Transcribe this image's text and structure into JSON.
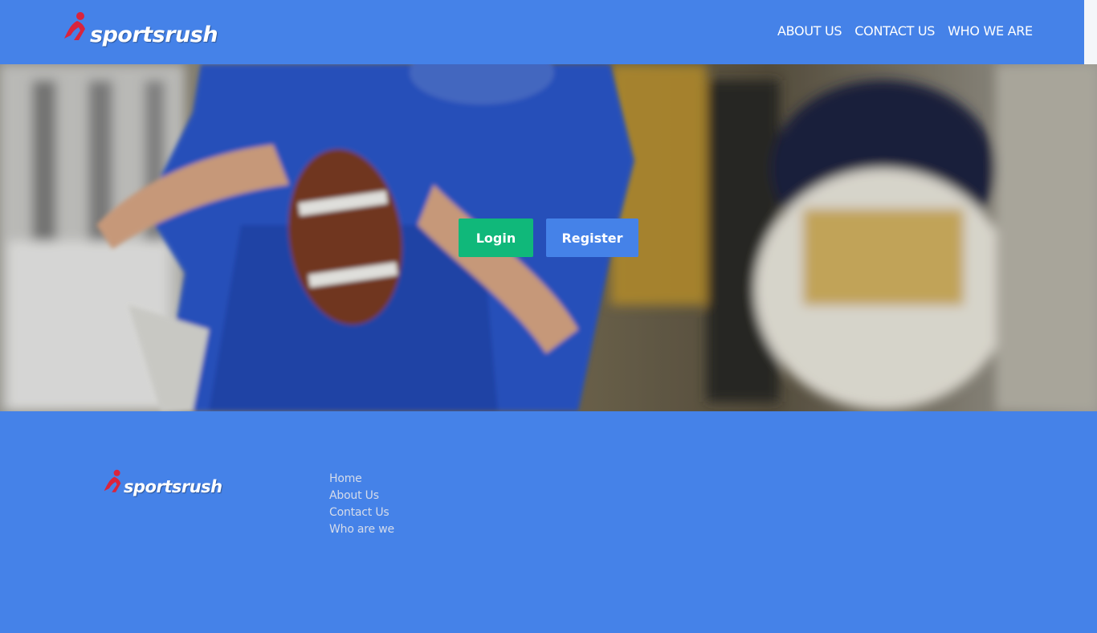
{
  "brand": {
    "name": "sportsrush"
  },
  "nav": {
    "items": [
      {
        "label": "ABOUT US"
      },
      {
        "label": "CONTACT US"
      },
      {
        "label": "WHO WE ARE"
      }
    ]
  },
  "hero": {
    "login_label": "Login",
    "register_label": "Register"
  },
  "footer": {
    "links": [
      {
        "label": "Home"
      },
      {
        "label": "About Us"
      },
      {
        "label": "Contact Us"
      },
      {
        "label": "Who are we"
      }
    ]
  },
  "colors": {
    "primary": "#4582e8",
    "login": "#10b87a",
    "footer_link": "#d6dcea",
    "logo_accent": "#d9243c"
  }
}
